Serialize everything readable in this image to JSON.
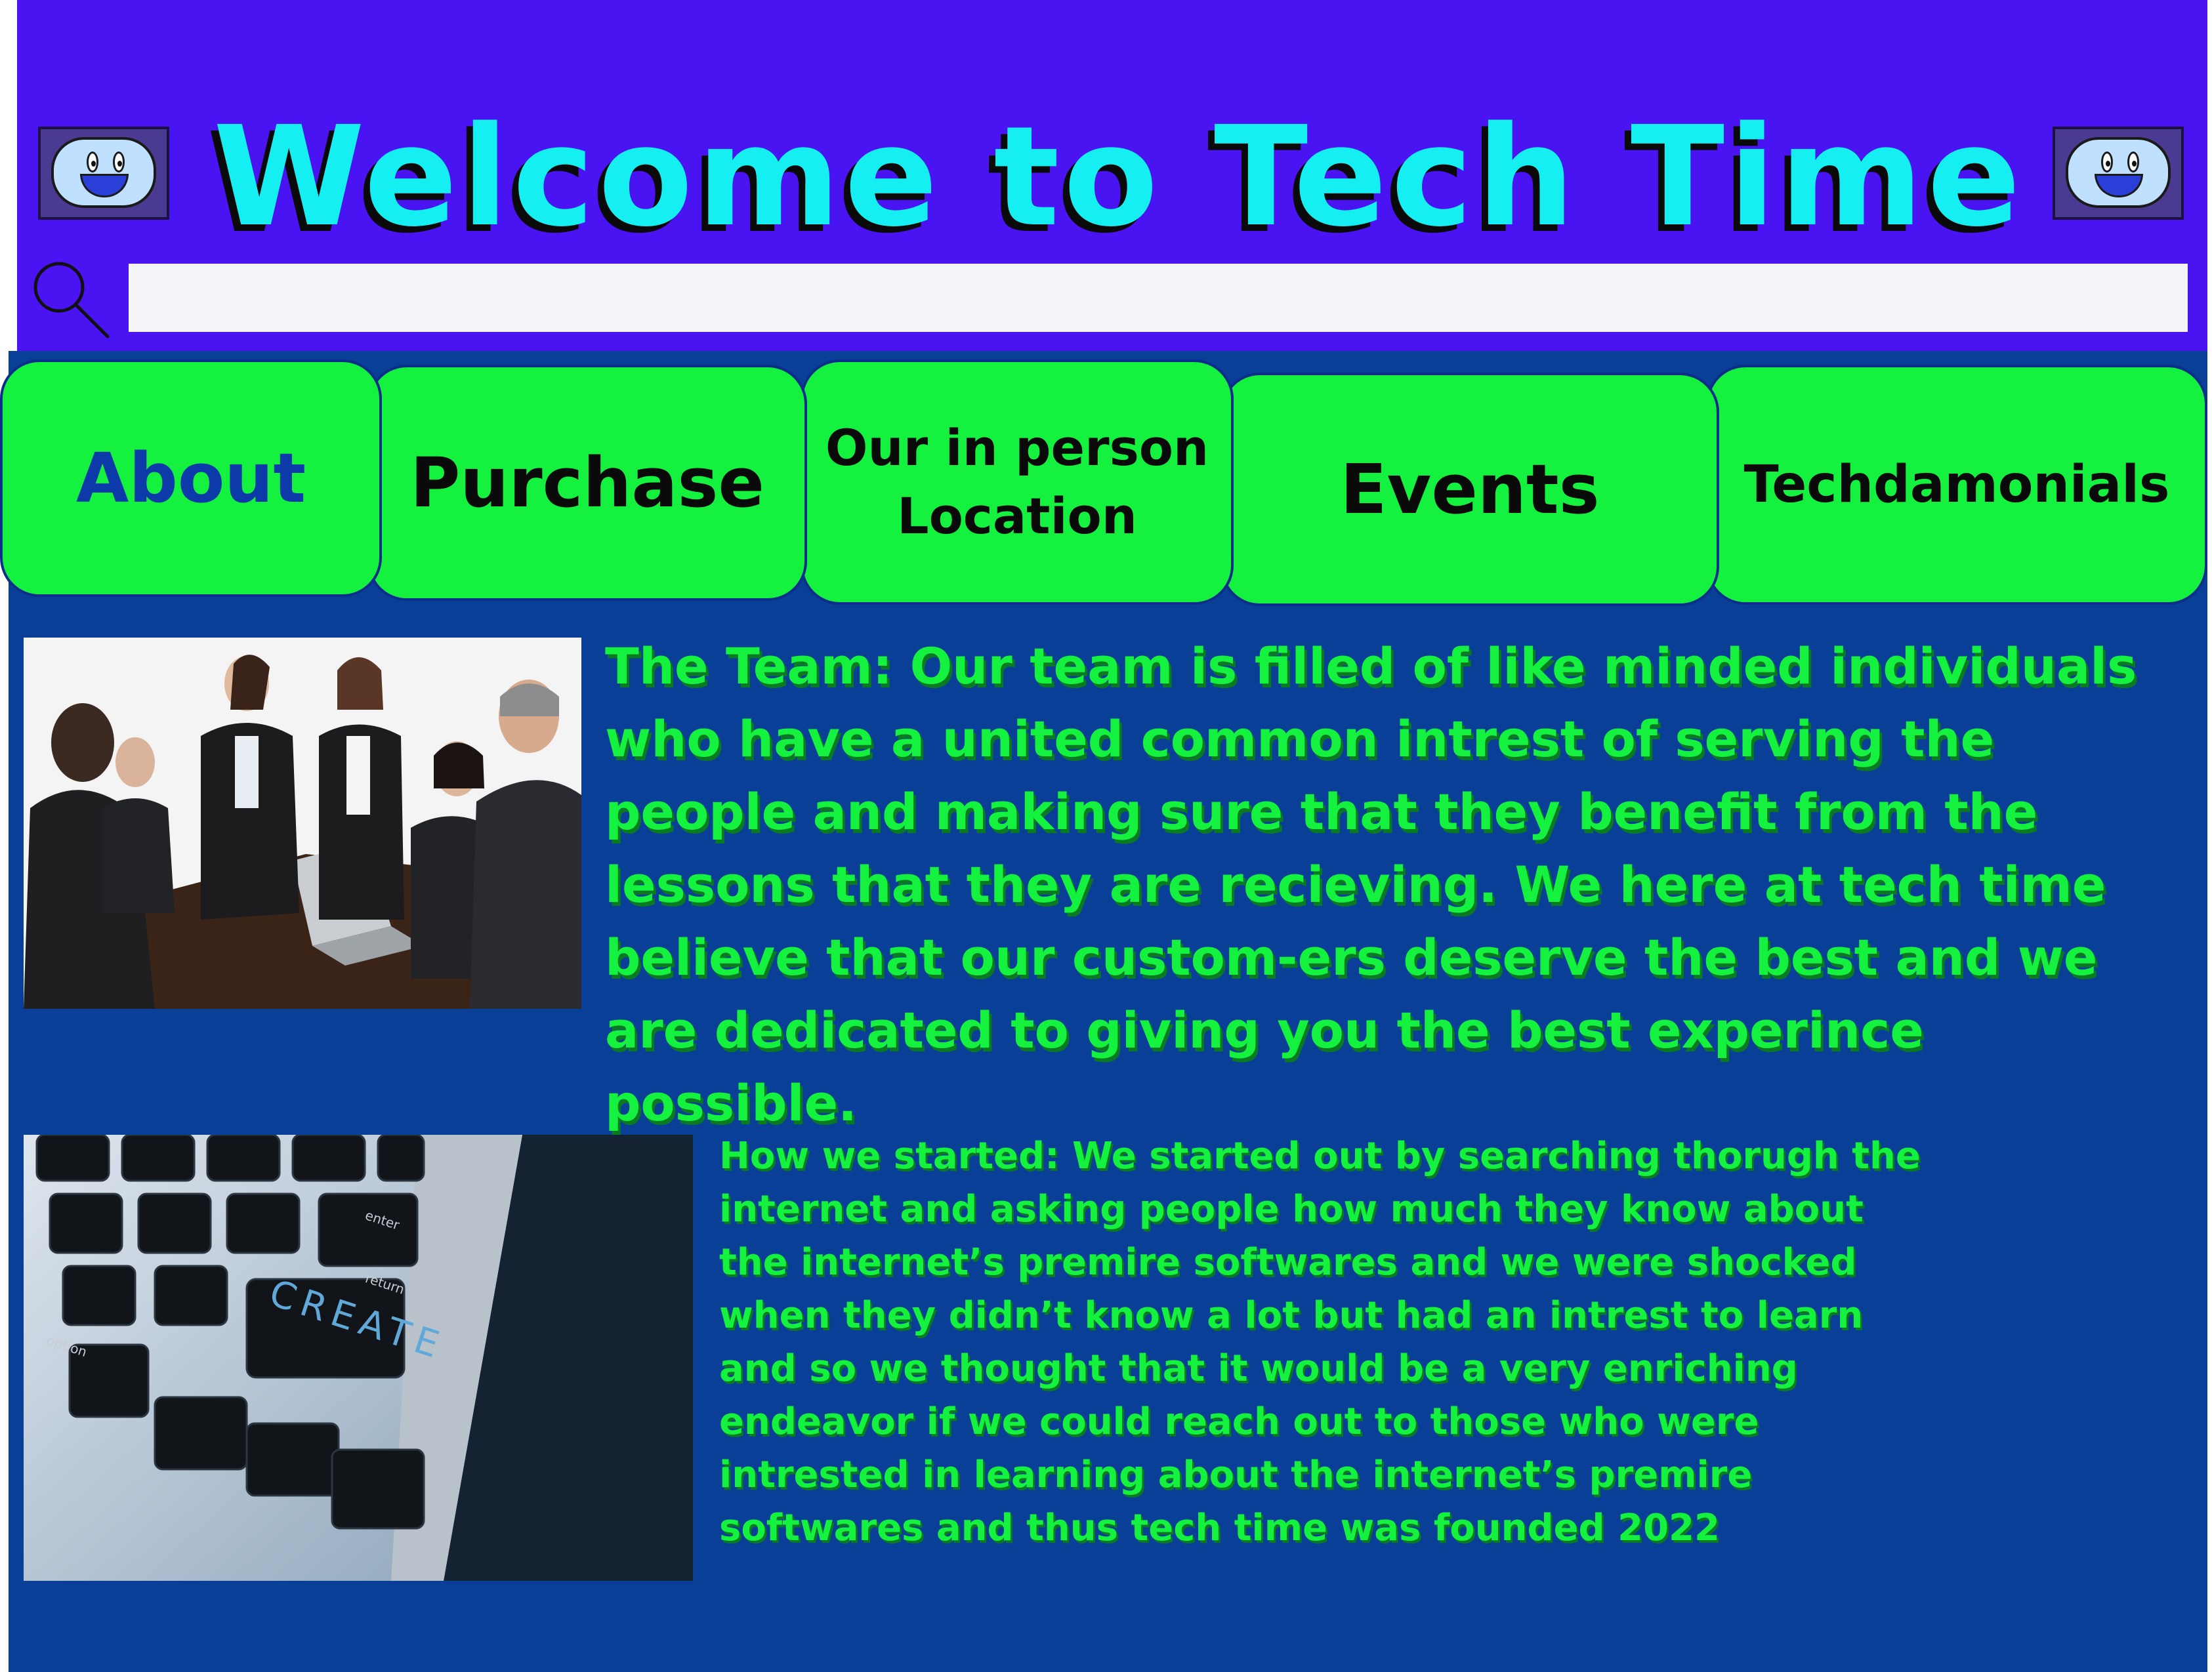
{
  "header": {
    "title": "Welcome to Tech Time",
    "search": {
      "value": "",
      "placeholder": "",
      "icon": "search-icon"
    },
    "mascot_icon": "smiley-face-icon"
  },
  "nav": {
    "tabs": [
      {
        "label": "About",
        "active": true
      },
      {
        "label": "Purchase"
      },
      {
        "label_lines": [
          "Our in person",
          "Location"
        ]
      },
      {
        "label": "Events"
      },
      {
        "label": "Techdamonials"
      }
    ]
  },
  "content": {
    "team_text": "The Team: Our team is filled of like minded individuals who have a united common intrest of serving the people and making sure that they benefit from the lessons that they are recieving. We here at tech time believe that our custom-ers deserve the best and we are dedicated to giving you the best experince possible.",
    "started_text": "How we started: We started out by searching thorugh the internet and asking people how much they know about the internet’s premire softwares and we were shocked when they didn’t know a lot but had an intrest to learn and so we thought that it would be a very enriching endeavor if we could reach out to those who were intrested in learning about the internet’s premire softwares and thus tech  time was founded 2022",
    "keyboard_keys": [
      "CREATE",
      "enter",
      "return",
      "option"
    ]
  },
  "colors": {
    "header_bg": "#4a13f2",
    "main_bg": "#093f96",
    "tab_green": "#15f13f",
    "title_cyan": "#16eff1",
    "active_tab_text": "#0c3aa8"
  }
}
